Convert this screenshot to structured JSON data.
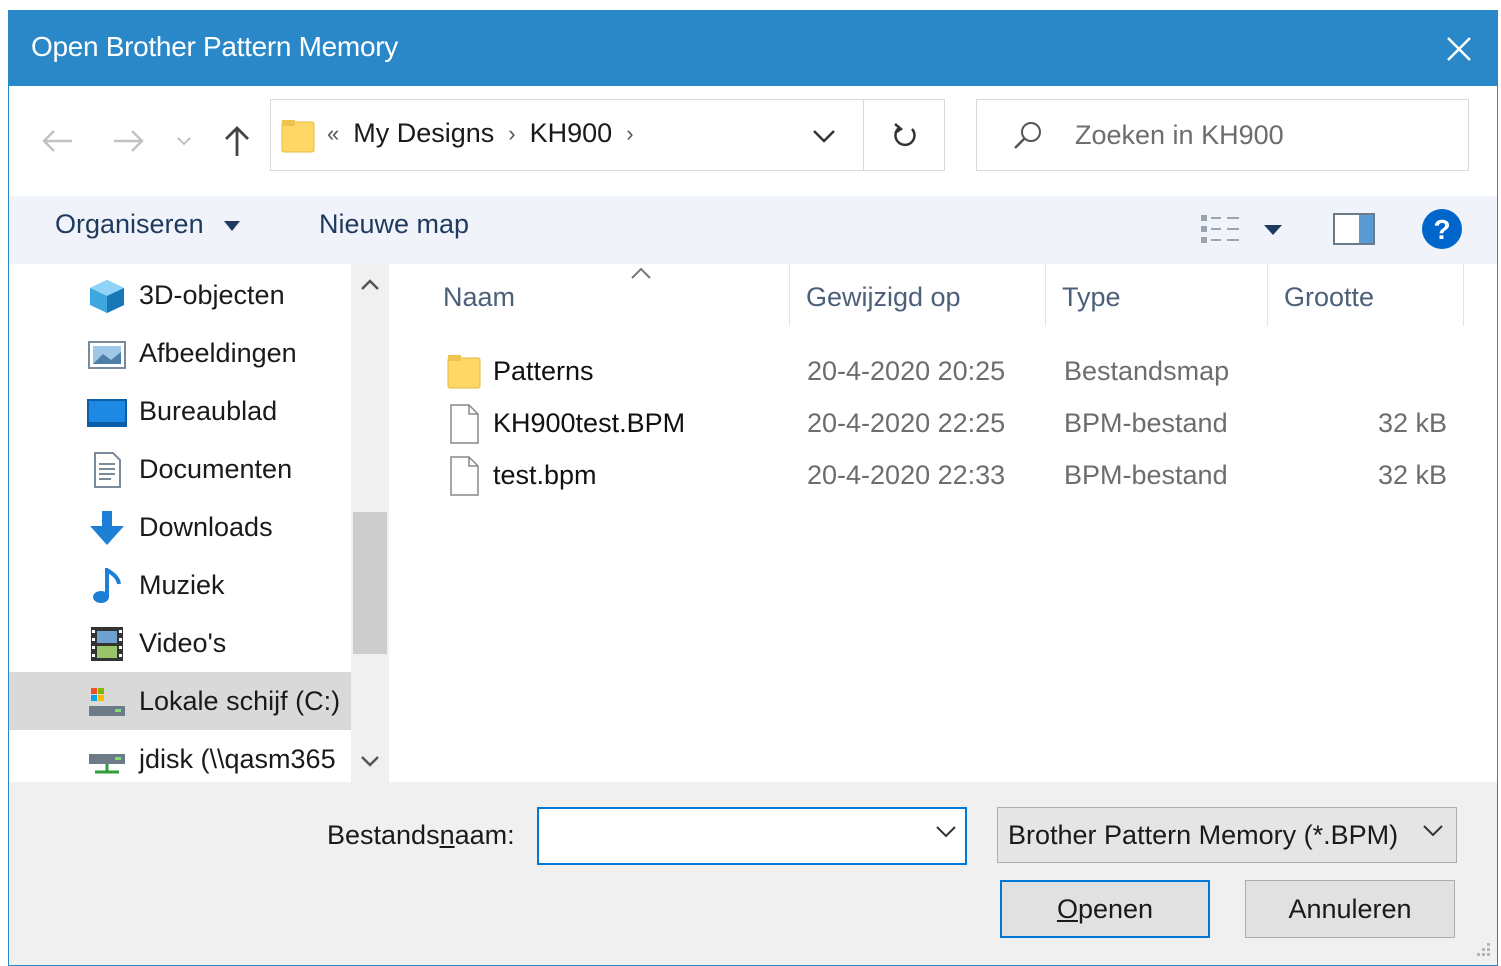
{
  "window": {
    "title": "Open Brother Pattern Memory"
  },
  "address": {
    "prefix": "«",
    "crumbs": [
      "My Designs",
      "KH900"
    ],
    "separator": "›"
  },
  "search": {
    "placeholder": "Zoeken in KH900"
  },
  "toolbar": {
    "organize_label": "Organiseren",
    "new_folder_label": "Nieuwe map"
  },
  "navpane": {
    "items": [
      {
        "label": "3D-objecten",
        "icon": "cube-icon"
      },
      {
        "label": "Afbeeldingen",
        "icon": "pictures-icon"
      },
      {
        "label": "Bureaublad",
        "icon": "desktop-icon"
      },
      {
        "label": "Documenten",
        "icon": "documents-icon"
      },
      {
        "label": "Downloads",
        "icon": "download-icon"
      },
      {
        "label": "Muziek",
        "icon": "music-icon"
      },
      {
        "label": "Video's",
        "icon": "video-icon"
      },
      {
        "label": "Lokale schijf (C:)",
        "icon": "drive-icon",
        "selected": true
      },
      {
        "label": "jdisk (\\\\qasm365",
        "icon": "network-drive-icon"
      }
    ]
  },
  "columns": {
    "name": "Naam",
    "modified": "Gewijzigd op",
    "type": "Type",
    "size": "Grootte"
  },
  "files": [
    {
      "name": "Patterns",
      "modified": "20-4-2020 20:25",
      "type": "Bestandsmap",
      "size": "",
      "icon": "folder-icon"
    },
    {
      "name": "KH900test.BPM",
      "modified": "20-4-2020 22:25",
      "type": "BPM-bestand",
      "size": "32 kB",
      "icon": "file-icon"
    },
    {
      "name": "test.bpm",
      "modified": "20-4-2020 22:33",
      "type": "BPM-bestand",
      "size": "32 kB",
      "icon": "file-icon"
    }
  ],
  "bottom": {
    "filename_label_pre": "Bestands",
    "filename_label_u": "n",
    "filename_label_post": "aam:",
    "filename_value": "",
    "filter_value": "Brother Pattern Memory (*.BPM)",
    "open_label_u": "O",
    "open_label_rest": "penen",
    "cancel_label": "Annuleren"
  },
  "colors": {
    "titlebar": "#2b88c8",
    "accent": "#0078d7",
    "toolbar_bg": "#f0f3f9",
    "selected_bg": "#d9d9d9"
  }
}
